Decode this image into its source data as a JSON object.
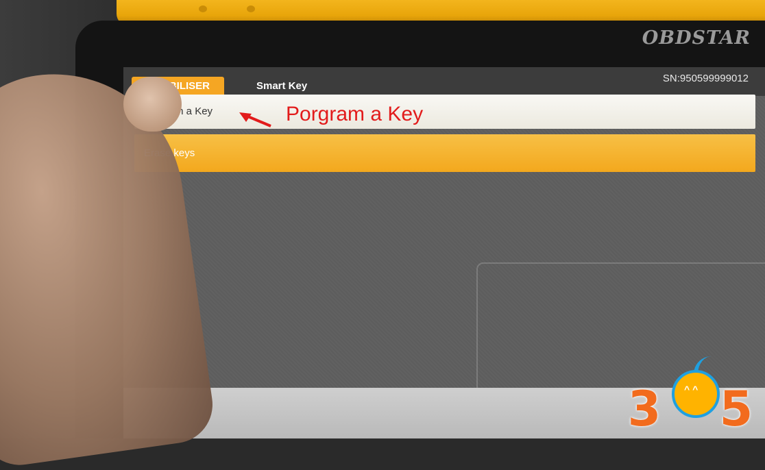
{
  "device": {
    "brand": "OBDSTAR"
  },
  "screen": {
    "tabs": [
      {
        "label": "IMMOBILISER",
        "active": true
      },
      {
        "label": "Smart Key",
        "active": false
      }
    ],
    "serial_number": "SN:950599999012",
    "menu": [
      {
        "label": "Program a Key",
        "selected": false
      },
      {
        "label": "Erase keys",
        "selected": true
      }
    ]
  },
  "annotation": {
    "text": "Porgram a Key",
    "color": "#e21b1b"
  },
  "watermark": {
    "digits": [
      "3",
      "6",
      "5"
    ],
    "colors": {
      "orange": "#f26b1d",
      "blue": "#1fa0e0",
      "yellow": "#ffb300"
    }
  },
  "colors": {
    "accent": "#f5a623",
    "device_yellow": "#f3b51d"
  }
}
